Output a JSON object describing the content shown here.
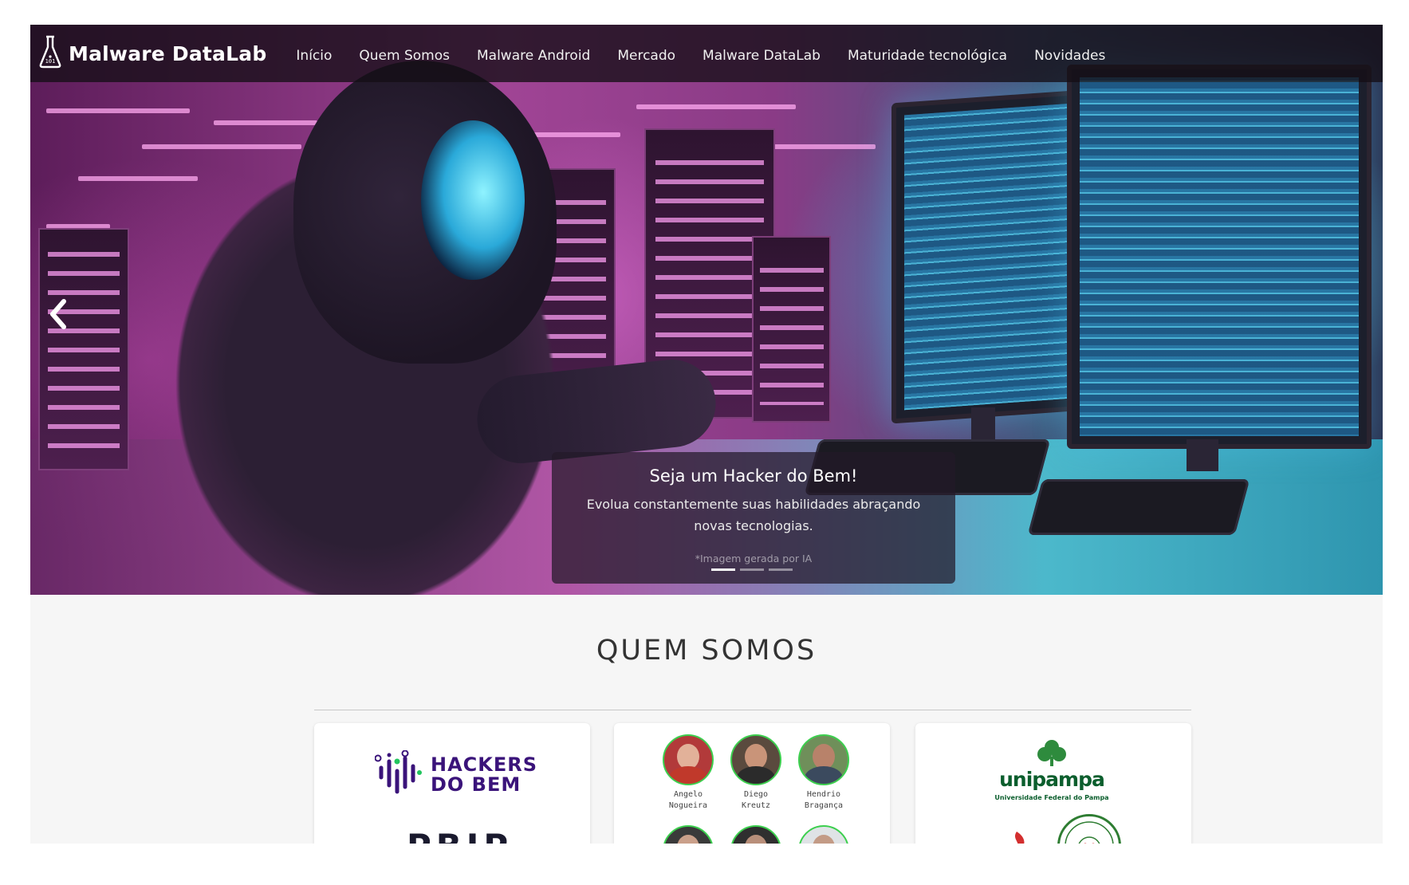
{
  "navbar": {
    "brand": "Malware DataLab",
    "items": [
      "Início",
      "Quem Somos",
      "Malware Android",
      "Mercado",
      "Malware DataLab",
      "Maturidade tecnológica",
      "Novidades"
    ]
  },
  "hero": {
    "caption_title": "Seja um Hacker do Bem!",
    "caption_text": "Evolua constantemente suas habilidades abraçando novas tecnologias.",
    "caption_note": "*Imagem gerada por IA",
    "slide_count": 3,
    "active_slide": 1
  },
  "section": {
    "title": "QUEM SOMOS"
  },
  "cards": {
    "partners_logo_1": "HACKERS DO BEM",
    "partners_logo_2": "PBIP",
    "members": [
      {
        "first": "Angelo",
        "last": "Nogueira"
      },
      {
        "first": "Diego",
        "last": "Kreutz"
      },
      {
        "first": "Hendrio",
        "last": "Bragança"
      }
    ],
    "university": "unipampa",
    "university_sub": "Universidade Federal do Pampa"
  },
  "colors": {
    "accent_green": "#3ccf4e",
    "hdb_purple": "#3a137a",
    "unipampa_green": "#0b5e2d"
  }
}
